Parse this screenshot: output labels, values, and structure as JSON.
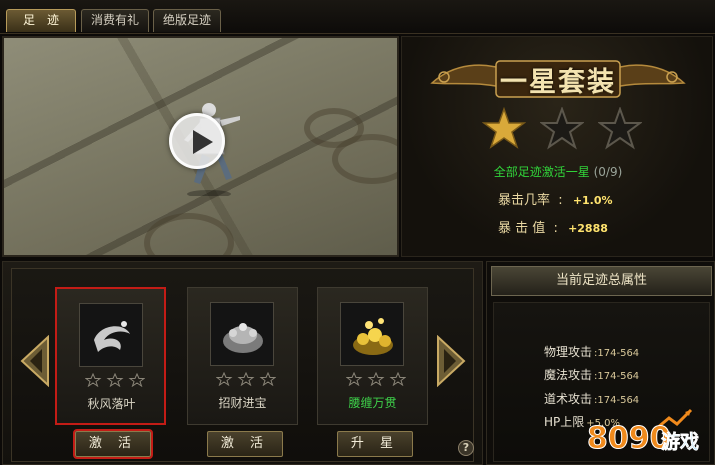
{
  "tabs": [
    {
      "label": "足　迹",
      "active": true
    },
    {
      "label": "消费有礼",
      "active": false
    },
    {
      "label": "绝版足迹",
      "active": false
    }
  ],
  "set": {
    "title": "一星套装",
    "stars_filled": 1,
    "stars_total": 3,
    "activation_text": "全部足迹激活一星",
    "activation_count": "(0/9)",
    "attributes": [
      {
        "label": "暴击几率",
        "value": "+1.0%"
      },
      {
        "label": "暴 击 值",
        "value": "+2888"
      }
    ]
  },
  "footprints": [
    {
      "name": "秋风落叶",
      "stars": 0,
      "selected": true,
      "button": "激 活",
      "color": "#d9d4c4"
    },
    {
      "name": "招财进宝",
      "stars": 0,
      "selected": false,
      "button": "激 活",
      "color": "#d9d4c4"
    },
    {
      "name": "腰缠万贯",
      "stars": 0,
      "selected": false,
      "button": "升 星",
      "color": "#3ed14a"
    }
  ],
  "help": "?",
  "total_attrs": {
    "title": "当前足迹总属性",
    "rows": [
      {
        "label": "物理攻击",
        "value": ":174-564"
      },
      {
        "label": "魔法攻击",
        "value": ":174-564"
      },
      {
        "label": "道术攻击",
        "value": ":174-564"
      },
      {
        "label": "HP上限",
        "value": "+5.0%"
      }
    ]
  },
  "watermark": {
    "number": "8090",
    "text": "游戏"
  },
  "colors": {
    "accent_gold": "#f3e3b0",
    "active_green": "#31d43a",
    "selected_red": "#c31c16",
    "value_yellow": "#ffe36e"
  }
}
